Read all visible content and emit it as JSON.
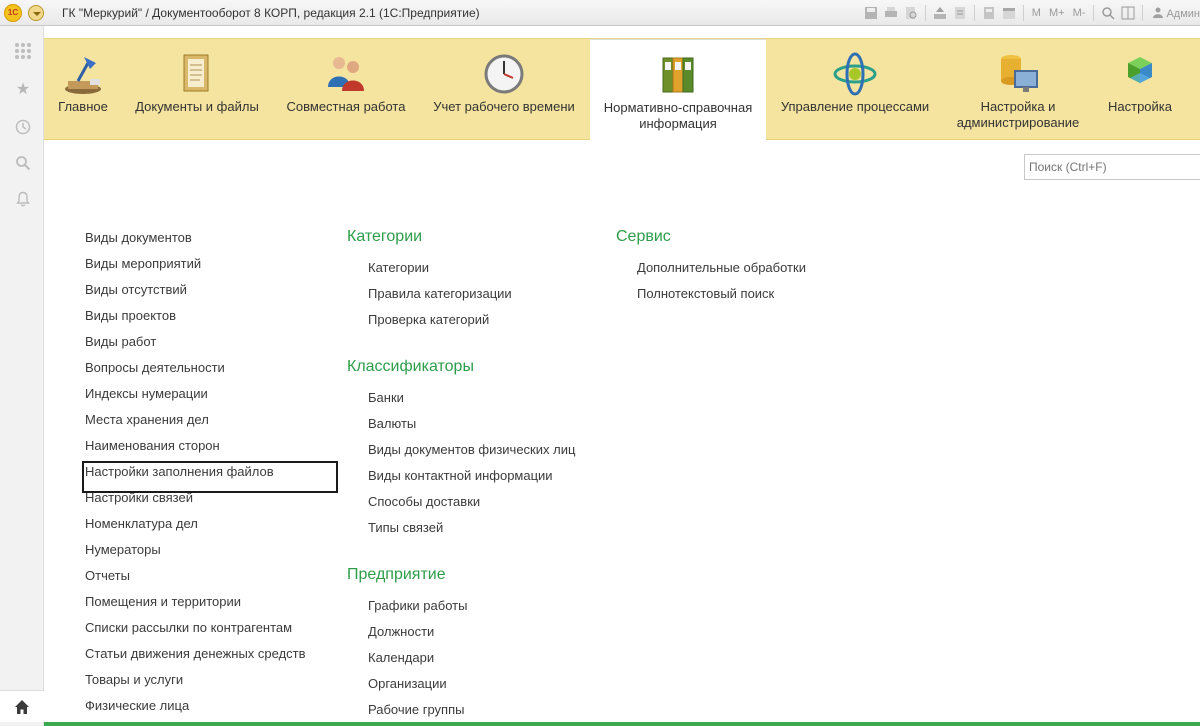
{
  "window": {
    "title": "ГК \"Меркурий\" / Документооборот 8 КОРП, редакция 2.1  (1С:Предприятие)",
    "logo": "1С",
    "user": "Админ"
  },
  "toolbar": {
    "m_label": "M",
    "m_plus_label": "M+",
    "m_minus_label": "M-"
  },
  "sections": [
    {
      "label": "Главное",
      "icon": "desk-lamp-icon"
    },
    {
      "label": "Документы и файлы",
      "icon": "documents-folder-icon"
    },
    {
      "label": "Совместная работа",
      "icon": "users-icon"
    },
    {
      "label": "Учет рабочего времени",
      "icon": "clock-icon"
    },
    {
      "label": "Нормативно-справочная информация",
      "icon": "binders-icon",
      "active": true
    },
    {
      "label": "Управление процессами",
      "icon": "process-icon"
    },
    {
      "label": "Настройка и администрирование",
      "icon": "database-computer-icon"
    },
    {
      "label": "Настройка",
      "icon": "cubes-icon"
    }
  ],
  "search": {
    "placeholder": "Поиск (Ctrl+F)"
  },
  "column1": {
    "items": [
      "Виды документов",
      "Виды мероприятий",
      "Виды отсутствий",
      "Виды проектов",
      "Виды работ",
      "Вопросы деятельности",
      "Индексы нумерации",
      "Места хранения дел",
      "Наименования сторон",
      "Настройки заполнения файлов",
      "Настройки связей",
      "Номенклатура дел",
      "Нумераторы",
      "Отчеты",
      "Помещения и территории",
      "Списки рассылки по контрагентам",
      "Статьи движения денежных средств",
      "Товары и услуги",
      "Физические лица"
    ],
    "selected_index": 9
  },
  "column2": {
    "groups": [
      {
        "title": "Категории",
        "items": [
          "Категории",
          "Правила категоризации",
          "Проверка категорий"
        ]
      },
      {
        "title": "Классификаторы",
        "items": [
          "Банки",
          "Валюты",
          "Виды документов физических лиц",
          "Виды контактной информации",
          "Способы доставки",
          "Типы связей"
        ]
      },
      {
        "title": "Предприятие",
        "items": [
          "Графики работы",
          "Должности",
          "Календари",
          "Организации",
          "Рабочие группы"
        ]
      }
    ]
  },
  "column3": {
    "groups": [
      {
        "title": "Сервис",
        "items": [
          "Дополнительные обработки",
          "Полнотекстовый поиск"
        ]
      }
    ]
  },
  "colors": {
    "section_bar": "#f4e49f",
    "group_title": "#2e9d4a",
    "accent": "#3aa94f"
  }
}
